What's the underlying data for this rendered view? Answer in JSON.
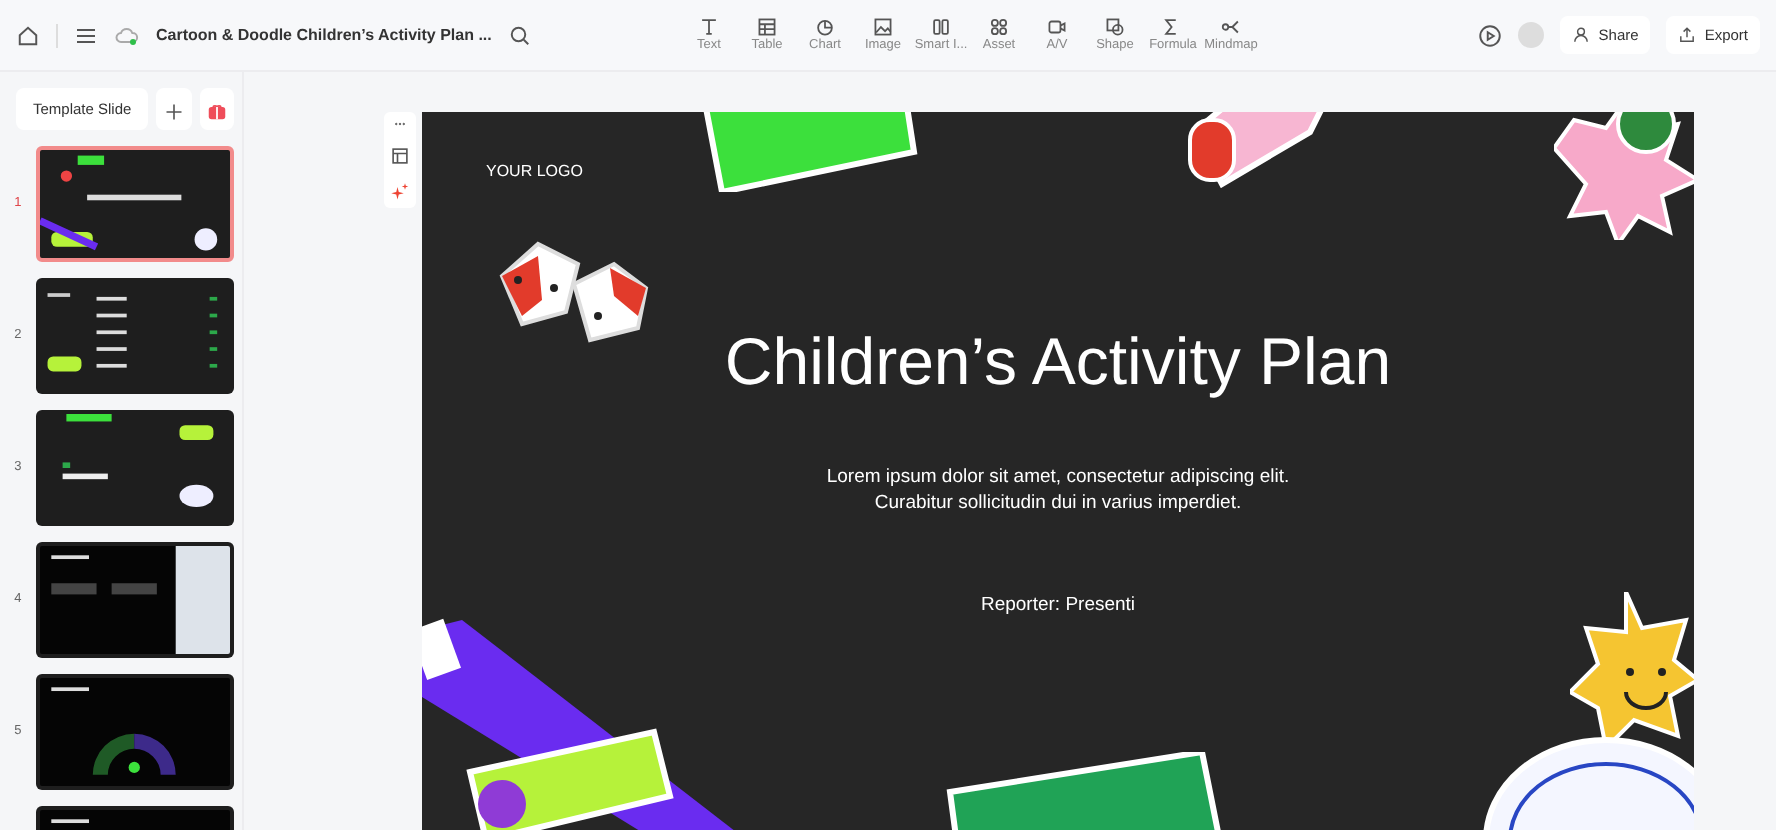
{
  "header": {
    "title": "Cartoon & Doodle Children’s Activity Plan ...",
    "share": "Share",
    "export": "Export"
  },
  "toolbar": [
    {
      "label": "Text",
      "kind": "text"
    },
    {
      "label": "Table",
      "kind": "table"
    },
    {
      "label": "Chart",
      "kind": "chart"
    },
    {
      "label": "Image",
      "kind": "image"
    },
    {
      "label": "Smart I...",
      "kind": "smart"
    },
    {
      "label": "Asset",
      "kind": "asset"
    },
    {
      "label": "A/V",
      "kind": "av"
    },
    {
      "label": "Shape",
      "kind": "shape"
    },
    {
      "label": "Formula",
      "kind": "formula"
    },
    {
      "label": "Mindmap",
      "kind": "mindmap"
    }
  ],
  "sidebar": {
    "template_button": "Template Slide",
    "slides": [
      {
        "number": "1",
        "selected": true,
        "kind": "title"
      },
      {
        "number": "2",
        "selected": false,
        "kind": "contents"
      },
      {
        "number": "3",
        "selected": false,
        "kind": "section"
      },
      {
        "number": "4",
        "selected": false,
        "kind": "photo"
      },
      {
        "number": "5",
        "selected": false,
        "kind": "chart"
      },
      {
        "selected": false,
        "kind": "plain"
      }
    ]
  },
  "slide": {
    "logo": "YOUR LOGO",
    "title": "Children’s Activity Plan",
    "subtitle": "Lorem ipsum dolor sit amet, consectetur adipiscing elit.\nCurabitur sollicitudin dui in varius imperdiet.",
    "reporter": "Reporter: Presenti"
  }
}
